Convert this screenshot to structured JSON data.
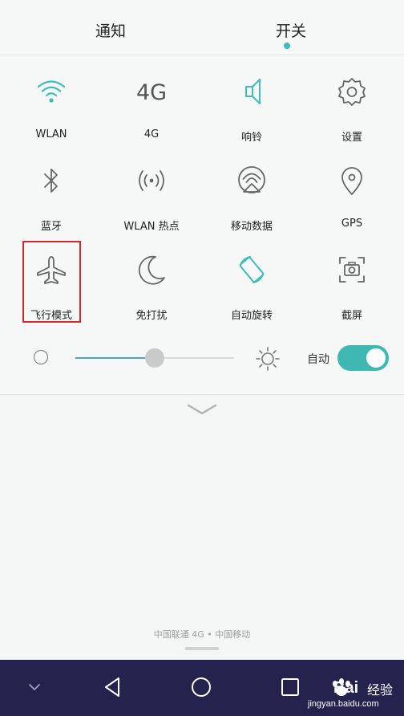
{
  "tabs": {
    "notifications": "通知",
    "switches": "开关"
  },
  "toggles": [
    {
      "label": "WLAN",
      "icon": "wifi-icon"
    },
    {
      "label": "4G",
      "icon": "4g-icon"
    },
    {
      "label": "响铃",
      "icon": "speaker-icon"
    },
    {
      "label": "设置",
      "icon": "gear-icon"
    },
    {
      "label": "蓝牙",
      "icon": "bluetooth-icon"
    },
    {
      "label": "WLAN 热点",
      "icon": "hotspot-icon"
    },
    {
      "label": "移动数据",
      "icon": "mobile-data-icon"
    },
    {
      "label": "GPS",
      "icon": "location-pin-icon"
    },
    {
      "label": "飞行模式",
      "icon": "airplane-icon"
    },
    {
      "label": "免打扰",
      "icon": "moon-icon"
    },
    {
      "label": "自动旋转",
      "icon": "rotate-icon"
    },
    {
      "label": "截屏",
      "icon": "screenshot-icon"
    }
  ],
  "icon_glyph": {
    "4g": "4G"
  },
  "brightness": {
    "level": 0.5,
    "auto_label": "自动",
    "auto_enabled": true
  },
  "carrier": "中国联通 4G • 中国移动",
  "watermark": {
    "brand": "Bai",
    "brand_suffix": "经验",
    "url": "jingyan.baidu.com"
  },
  "colors": {
    "accent": "#3dbdbb",
    "highlight": "#d2282e",
    "navbar": "#24234d"
  }
}
